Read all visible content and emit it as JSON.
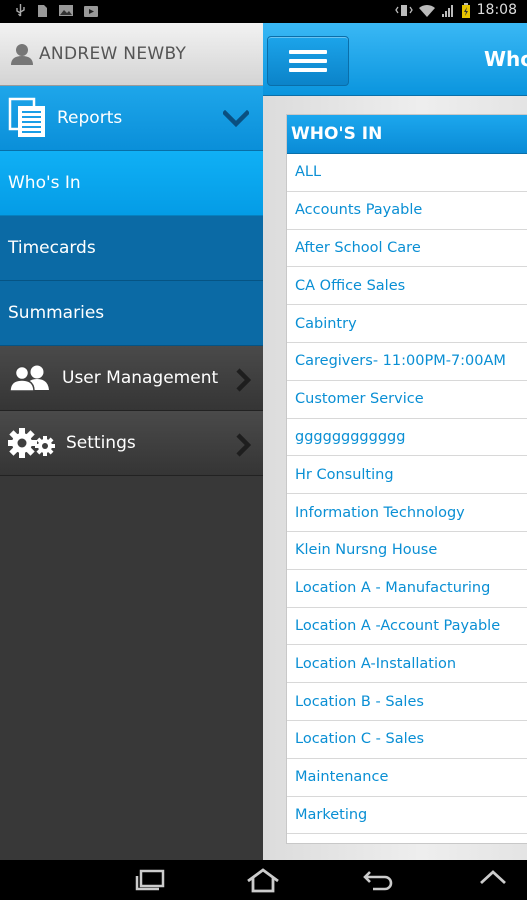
{
  "status_bar": {
    "time": "18:08",
    "left_icons": [
      "usb-icon",
      "sd-card-icon",
      "image-icon",
      "play-store-icon"
    ],
    "right_icons": [
      "vibrate-icon",
      "wifi-icon",
      "signal-icon",
      "battery-icon"
    ]
  },
  "sidebar": {
    "user_name": "ANDREW NEWBY",
    "items": [
      {
        "label": "Reports",
        "icon": "reports-icon",
        "indicator": "chevron-down-icon"
      },
      {
        "label": "Who's In"
      },
      {
        "label": "Timecards"
      },
      {
        "label": "Summaries"
      },
      {
        "label": "User Management",
        "icon": "users-icon",
        "indicator": "chevron-right-icon"
      },
      {
        "label": "Settings",
        "icon": "gears-icon",
        "indicator": "chevron-right-icon"
      }
    ]
  },
  "topbar": {
    "title": "Who's In",
    "menu_icon": "hamburger-icon"
  },
  "list": {
    "header": "WHO'S IN",
    "rows": [
      "ALL",
      "Accounts Payable",
      "After School Care",
      "CA Office Sales",
      "Cabintry",
      "Caregivers- 11:00PM-7:00AM",
      "Customer Service",
      "gggggggggggg",
      "Hr Consulting",
      "Information Technology",
      "Klein Nursng House",
      "Location A - Manufacturing",
      "Location A -Account Payable",
      "Location A-Installation",
      "Location B - Sales",
      "Location C - Sales",
      "Maintenance",
      "Marketing"
    ]
  },
  "colors": {
    "accent_blue": "#0a95de",
    "sidebar_dark": "#383838",
    "sub_item_blue": "#0b6aa5",
    "link_blue": "#0a8fd4"
  },
  "nav_bar": [
    "recent-apps-icon",
    "home-icon",
    "back-icon",
    "up-icon"
  ]
}
